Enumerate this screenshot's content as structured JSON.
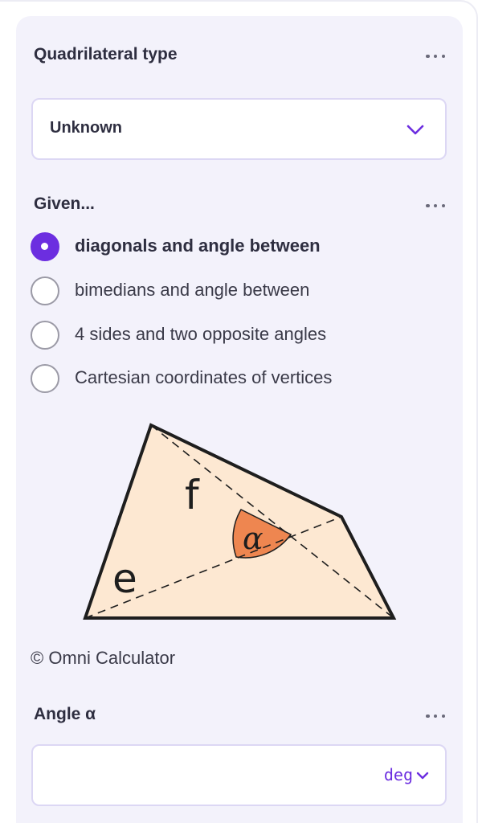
{
  "quad_type": {
    "label": "Quadrilateral type",
    "more_icon": "more-dots-icon",
    "value": "Unknown",
    "chevron_icon": "chevron-down-icon"
  },
  "given": {
    "label": "Given...",
    "options": [
      {
        "label": "diagonals and angle between",
        "selected": true
      },
      {
        "label": "bimedians and angle between",
        "selected": false
      },
      {
        "label": "4 sides and two opposite angles",
        "selected": false
      },
      {
        "label": "Cartesian coordinates of vertices",
        "selected": false
      }
    ]
  },
  "diagram": {
    "labels": {
      "f": "f",
      "e": "e",
      "alpha": "α"
    },
    "colors": {
      "fill": "#fde8d2",
      "angle": "#ee8650",
      "stroke": "#1e1e1e"
    }
  },
  "copyright": "© Omni Calculator",
  "angle": {
    "label": "Angle α",
    "value": "",
    "unit": "deg"
  },
  "accent_color": "#6c2ee0"
}
